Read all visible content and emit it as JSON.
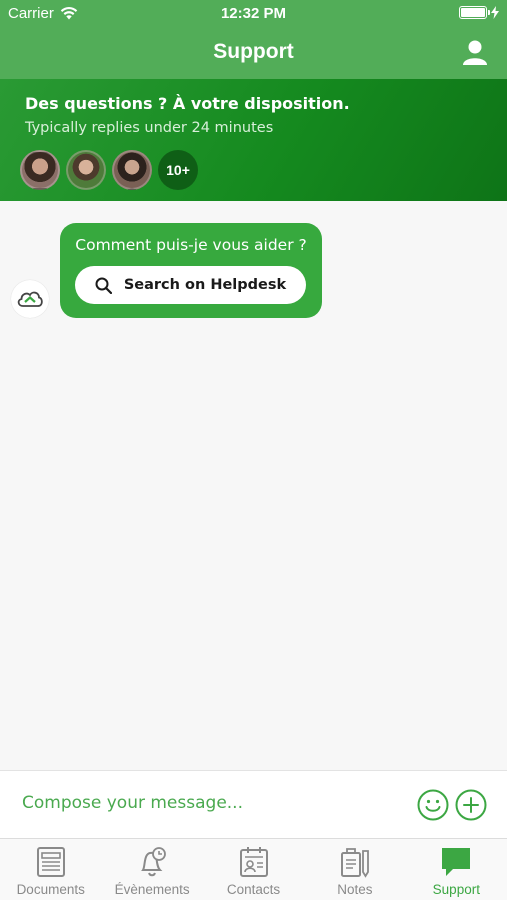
{
  "status_bar": {
    "carrier": "Carrier",
    "time": "12:32 PM"
  },
  "nav": {
    "title": "Support",
    "profile_icon": "user-icon"
  },
  "header": {
    "title": "Des questions ? À votre disposition.",
    "subtitle": "Typically replies under 24 minutes",
    "more_count": "10+"
  },
  "chat": {
    "message": "Comment puis-je vous aider ?",
    "helpdesk_button": "Search on Helpdesk"
  },
  "composer": {
    "placeholder": "Compose your message..."
  },
  "tabs": [
    {
      "label": "Documents",
      "icon": "documents-icon"
    },
    {
      "label": "Évènements",
      "icon": "bell-clock-icon"
    },
    {
      "label": "Contacts",
      "icon": "contacts-icon"
    },
    {
      "label": "Notes",
      "icon": "notes-icon"
    },
    {
      "label": "Support",
      "icon": "chat-bubble-icon"
    }
  ],
  "colors": {
    "accent": "#52ad58",
    "header_dark": "#158a1f",
    "bubble": "#37a93e"
  }
}
